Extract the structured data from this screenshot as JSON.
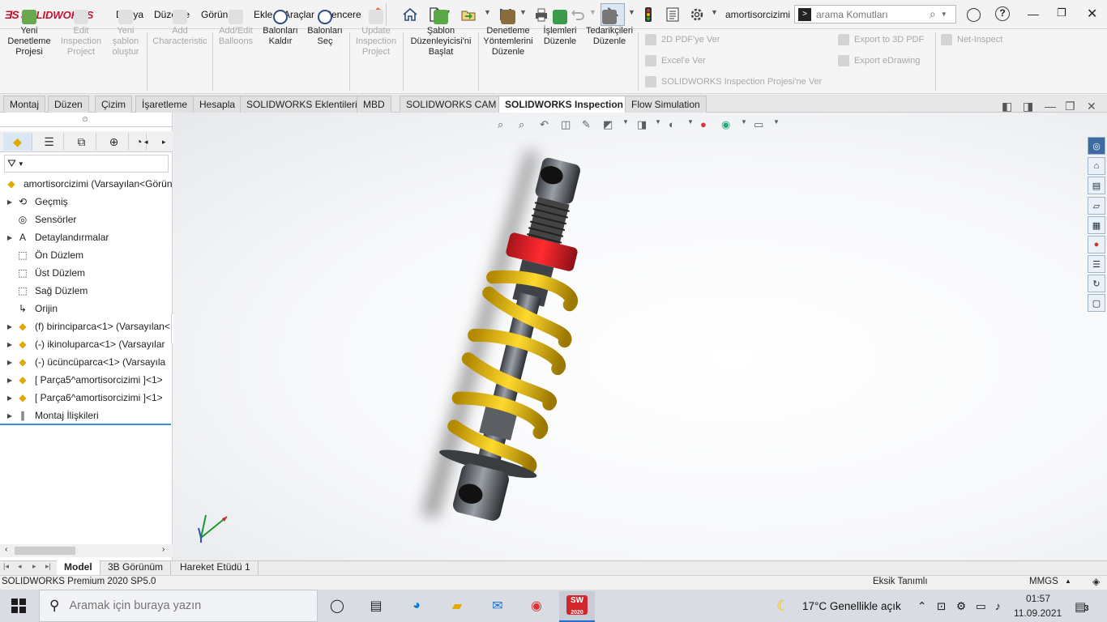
{
  "app": {
    "brand": "SOLIDWORKS",
    "brand_color": "#c8102e",
    "document": "amortisorcizimi"
  },
  "menu": [
    "Dosya",
    "Düzenle",
    "Görünüm",
    "Ekle",
    "Araçlar",
    "Pencere"
  ],
  "toolbar_icons": [
    "home-icon",
    "new-document-icon",
    "open-icon",
    "save-icon",
    "print-icon",
    "undo-icon",
    "select-icon",
    "rebuild-icon",
    "file-properties-icon",
    "options-icon"
  ],
  "search": {
    "placeholder": "arama Komutları"
  },
  "commands": [
    {
      "label1": "Yeni",
      "label2": "Denetleme",
      "label3": "Projesi",
      "enabled": true
    },
    {
      "label1": "Edit",
      "label2": "Inspection",
      "label3": "Project",
      "enabled": false
    },
    {
      "label1": "Yeni",
      "label2": "şablon",
      "label3": "oluştur",
      "enabled": false
    },
    {
      "label1": "Add",
      "label2": "Characteristic",
      "label3": "",
      "enabled": false
    },
    {
      "label1": "Add/Edit",
      "label2": "Balloons",
      "label3": "",
      "enabled": false
    },
    {
      "label1": "Balonları",
      "label2": "Kaldır",
      "label3": "",
      "enabled": true
    },
    {
      "label1": "Balonları",
      "label2": "Seç",
      "label3": "",
      "enabled": true
    },
    {
      "label1": "Update",
      "label2": "Inspection",
      "label3": "Project",
      "enabled": false
    },
    {
      "label1": "Şablon",
      "label2": "Düzenleyicisi'ni",
      "label3": "Başlat",
      "enabled": true
    },
    {
      "label1": "Denetleme",
      "label2": "Yöntemlerini",
      "label3": "Düzenle",
      "enabled": true
    },
    {
      "label1": "İşlemleri",
      "label2": "Düzenle",
      "label3": "",
      "enabled": true
    },
    {
      "label1": "Tedarikçileri",
      "label2": "Düzenle",
      "label3": "",
      "enabled": true
    }
  ],
  "export": {
    "pdf2d": "2D PDF'ye Ver",
    "excel": "Excel'e Ver",
    "project": "SOLIDWORKS Inspection Projesi'ne Ver",
    "pdf3d": "Export to 3D PDF",
    "edrawing": "Export eDrawing",
    "netinspect": "Net-Inspect"
  },
  "tabs": [
    "Montaj",
    "Düzen",
    "Çizim",
    "İşaretleme",
    "Hesapla",
    "SOLIDWORKS Eklentileri",
    "MBD",
    "SOLIDWORKS CAM",
    "SOLIDWORKS Inspection",
    "Flow Simulation"
  ],
  "active_tab": "SOLIDWORKS Inspection",
  "tree": {
    "root": "amortisorcizimi  (Varsayılan<Görün",
    "items": [
      {
        "label": "Geçmiş",
        "icon": "history-icon",
        "expand": true
      },
      {
        "label": "Sensörler",
        "icon": "sensor-icon",
        "expand": false
      },
      {
        "label": "Detaylandırmalar",
        "icon": "annotation-icon",
        "expand": true
      },
      {
        "label": "Ön Düzlem",
        "icon": "plane-icon",
        "expand": false
      },
      {
        "label": "Üst Düzlem",
        "icon": "plane-icon",
        "expand": false
      },
      {
        "label": "Sağ Düzlem",
        "icon": "plane-icon",
        "expand": false
      },
      {
        "label": "Orijin",
        "icon": "origin-icon",
        "expand": false
      },
      {
        "label": "(f) birinciparca<1> (Varsayılan<",
        "icon": "part-icon",
        "expand": true
      },
      {
        "label": "(-) ikinoluparca<1> (Varsayılar",
        "icon": "part-icon",
        "expand": true
      },
      {
        "label": "(-) ücüncüparca<1> (Varsayıla",
        "icon": "part-icon",
        "expand": true
      },
      {
        "label": "[ Parça5^amortisorcizimi ]<1>",
        "icon": "part-icon",
        "expand": true
      },
      {
        "label": "[ Parça6^amortisorcizimi ]<1>",
        "icon": "part-icon",
        "expand": true
      },
      {
        "label": "Montaj İlişkileri",
        "icon": "mates-icon",
        "expand": true
      }
    ]
  },
  "bottom_tabs": [
    "Model",
    "3B Görünüm",
    "Hareket Etüdü 1"
  ],
  "status": {
    "left": "SOLIDWORKS Premium 2020 SP5.0",
    "mid": "Eksik Tanımlı",
    "units": "MMGS"
  },
  "taskbar": {
    "search_placeholder": "Aramak için buraya yazın",
    "weather": "17°C  Genellikle açık",
    "time": "01:57",
    "date": "11.09.2021",
    "notifications": "3",
    "sw_badge": "2020"
  },
  "colors": {
    "spring": "#e8b800",
    "nut": "#d61f26",
    "viewport_bg": "#f7f8fa"
  }
}
